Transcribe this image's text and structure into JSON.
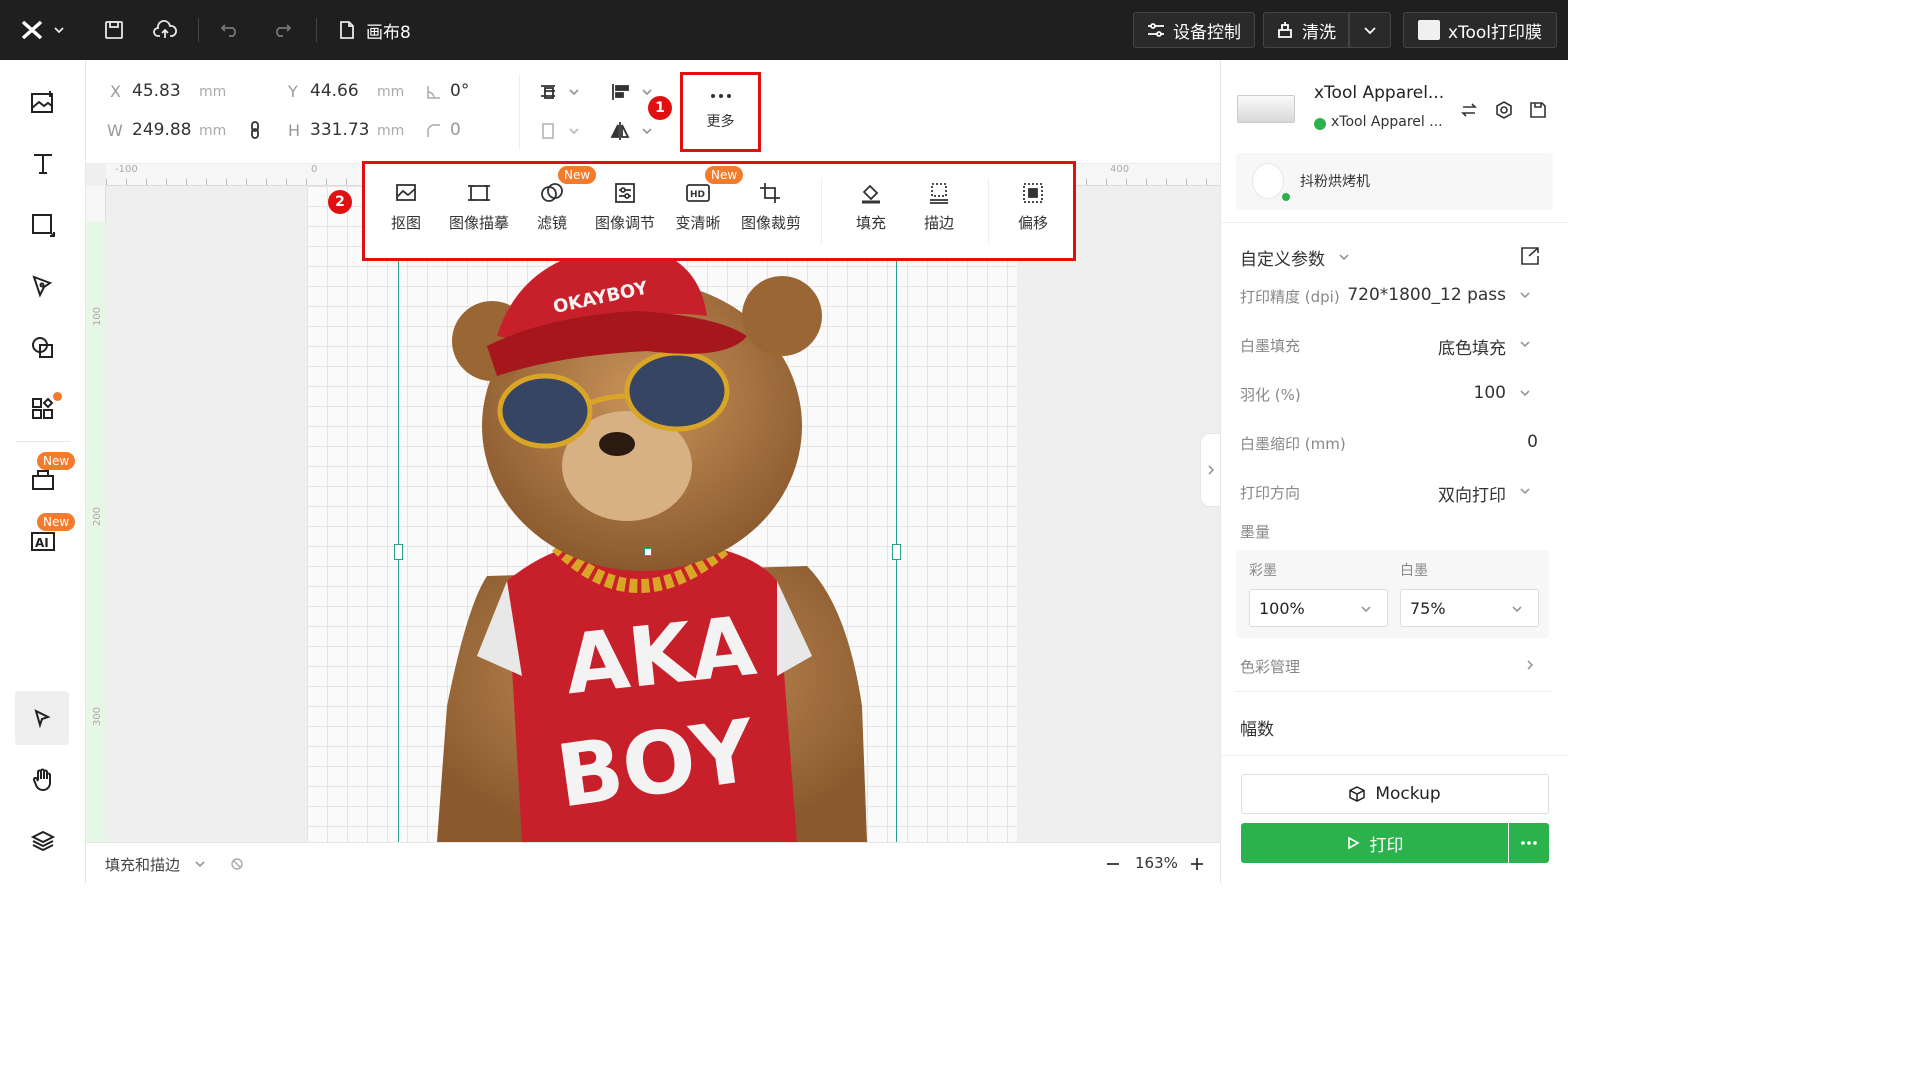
{
  "topbar": {
    "canvas_name": "画布8",
    "device_control": "设备控制",
    "clean": "清洗",
    "print_film": "xTool打印膜"
  },
  "leftbar": {
    "badges": [
      "New",
      "New"
    ]
  },
  "properties": {
    "x_label": "X",
    "x_value": "45.83",
    "x_unit": "mm",
    "y_label": "Y",
    "y_value": "44.66",
    "y_unit": "mm",
    "rotation": "0°",
    "w_label": "W",
    "w_value": "249.88",
    "w_unit": "mm",
    "h_label": "H",
    "h_value": "331.73",
    "h_unit": "mm",
    "corner": "0"
  },
  "more_button": {
    "label": "更多",
    "step": "1"
  },
  "context_toolbar": {
    "step": "2",
    "items": [
      {
        "label": "抠图",
        "icon": "cutout-icon"
      },
      {
        "label": "图像描摹",
        "icon": "trace-icon"
      },
      {
        "label": "滤镜",
        "icon": "filter-icon",
        "badge": "New"
      },
      {
        "label": "图像调节",
        "icon": "adjust-icon"
      },
      {
        "label": "变清晰",
        "icon": "hd-icon",
        "badge": "New"
      },
      {
        "label": "图像裁剪",
        "icon": "crop-icon"
      },
      {
        "label": "填充",
        "icon": "fill-icon"
      },
      {
        "label": "描边",
        "icon": "stroke-icon"
      },
      {
        "label": "偏移",
        "icon": "offset-icon"
      }
    ]
  },
  "rulers": {
    "h_ticks": [
      "-100",
      "0",
      "400"
    ],
    "v_ticks": [
      "100",
      "200",
      "300"
    ]
  },
  "artwork": {
    "shirt_text_1": "AKA",
    "shirt_text_2": "BOY",
    "cap_text": "OKAYBOY"
  },
  "statusbar": {
    "mode": "填充和描边",
    "zoom": "163%"
  },
  "right_panel": {
    "device_name": "xTool Apparel...",
    "device_status": "xTool Apparel ...",
    "accessory": "抖粉烘烤机",
    "section_title": "自定义参数",
    "params": [
      {
        "label": "打印精度 (dpi)",
        "value": "720*1800_12 pass"
      },
      {
        "label": "白墨填充",
        "value": "底色填充"
      },
      {
        "label": "羽化 (%)",
        "value": "100"
      },
      {
        "label": "白墨缩印 (mm)",
        "value": "0"
      },
      {
        "label": "打印方向",
        "value": "双向打印"
      }
    ],
    "ink_title": "墨量",
    "color_ink_label": "彩墨",
    "color_ink_value": "100%",
    "white_ink_label": "白墨",
    "white_ink_value": "75%",
    "color_mgmt": "色彩管理",
    "copies": "幅数",
    "mockup": "Mockup",
    "print": "打印"
  },
  "colors": {
    "accent": "#2bb24c",
    "highlight": "#e01010",
    "badge": "#f47a2c",
    "topbar": "#1f1f1f"
  }
}
